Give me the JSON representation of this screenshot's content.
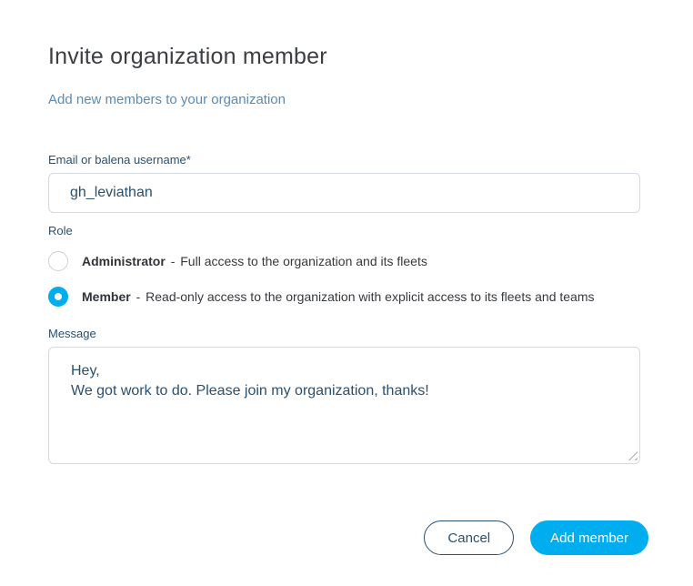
{
  "page": {
    "title": "Invite organization member",
    "subtitle": "Add new members to your organization"
  },
  "form": {
    "email": {
      "label": "Email or balena username*",
      "value": "gh_leviathan"
    },
    "role": {
      "label": "Role",
      "separator": "-",
      "options": [
        {
          "name": "Administrator",
          "description": "Full access to the organization and its fleets",
          "selected": false
        },
        {
          "name": "Member",
          "description": "Read-only access to the organization with explicit access to its fleets and teams",
          "selected": true
        }
      ]
    },
    "message": {
      "label": "Message",
      "value": "Hey,\nWe got work to do. Please join my organization, thanks!"
    }
  },
  "actions": {
    "cancel_label": "Cancel",
    "submit_label": "Add member"
  },
  "colors": {
    "primary": "#00aeef",
    "label_navy": "#2a506f",
    "heading": "#3b3e42",
    "subtitle": "#5d8ab0",
    "border": "#d5dae2"
  }
}
